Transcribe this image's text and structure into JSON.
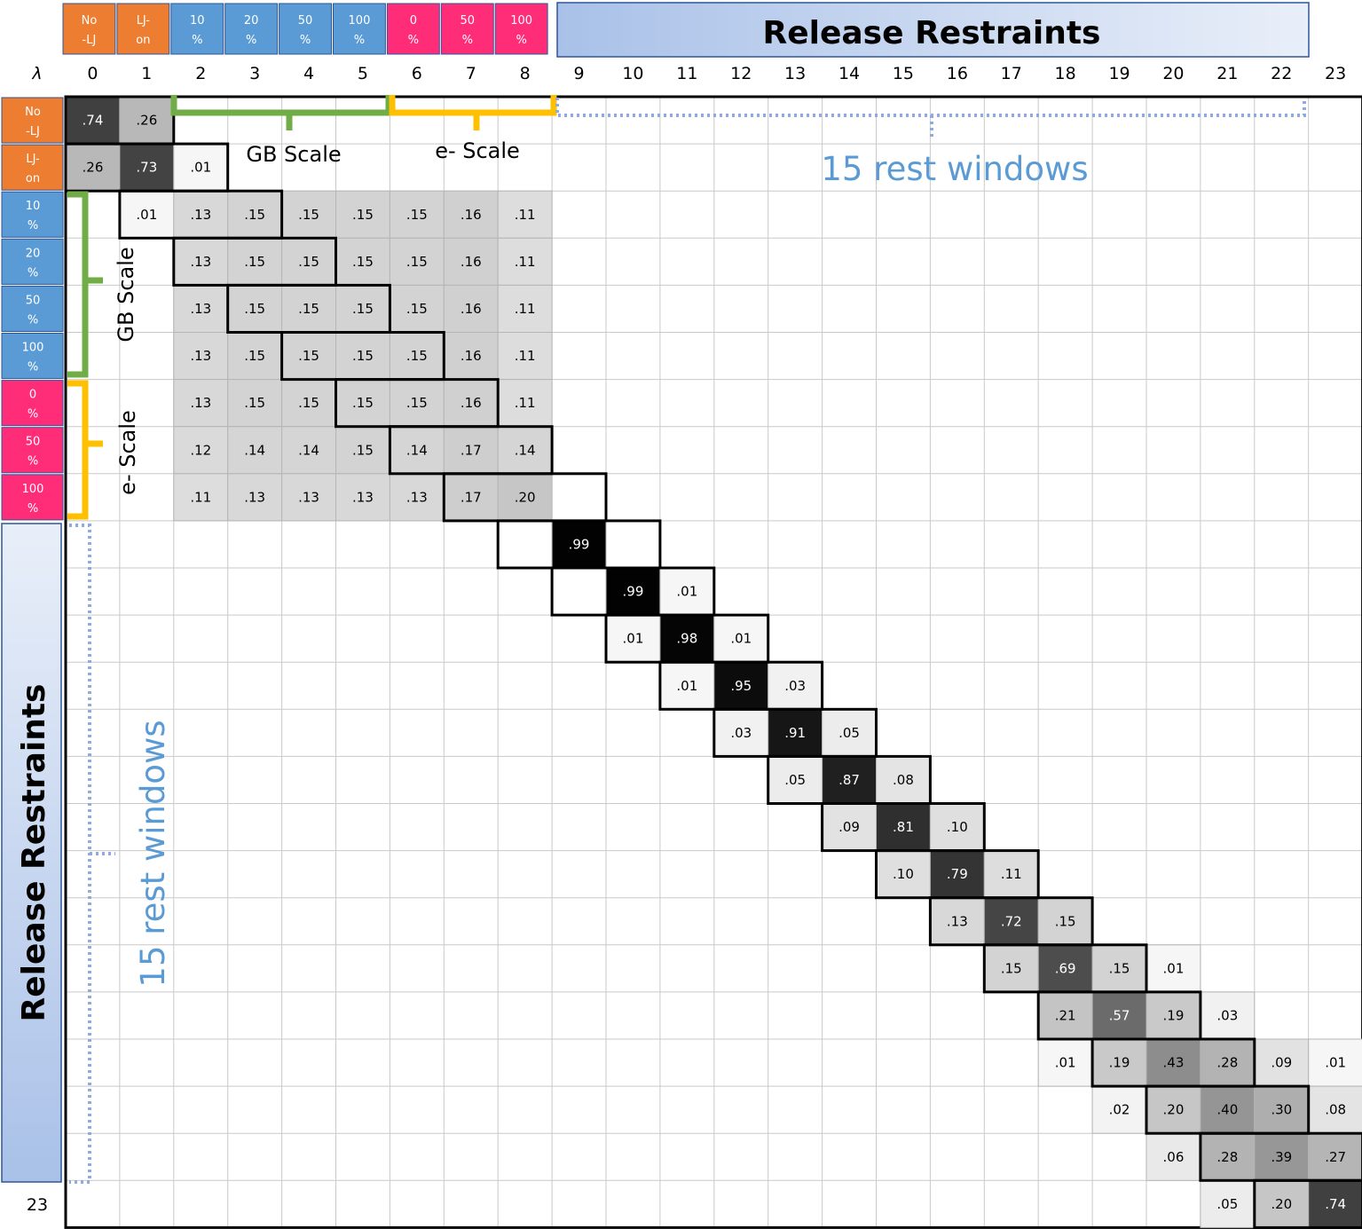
{
  "chart_data": {
    "type": "heatmap",
    "title": "",
    "lambda_symbol": "λ",
    "column_indices": [
      "0",
      "1",
      "2",
      "3",
      "4",
      "5",
      "6",
      "7",
      "8",
      "9",
      "10",
      "11",
      "12",
      "13",
      "14",
      "15",
      "16",
      "17",
      "18",
      "19",
      "20",
      "21",
      "22",
      "23"
    ],
    "row_bottom_index": "23",
    "banner_title": "Release Restraints",
    "state_labels": [
      {
        "line1": "No",
        "line2": "-LJ",
        "group": "lj"
      },
      {
        "line1": "LJ-",
        "line2": "on",
        "group": "lj"
      },
      {
        "line1": "10",
        "line2": "%",
        "group": "gb"
      },
      {
        "line1": "20",
        "line2": "%",
        "group": "gb"
      },
      {
        "line1": "50",
        "line2": "%",
        "group": "gb"
      },
      {
        "line1": "100",
        "line2": "%",
        "group": "gb"
      },
      {
        "line1": "0",
        "line2": "%",
        "group": "e"
      },
      {
        "line1": "50",
        "line2": "%",
        "group": "e"
      },
      {
        "line1": "100",
        "line2": "%",
        "group": "e"
      }
    ],
    "group_colors": {
      "lj": "#ed7d31",
      "gb": "#5b9bd5",
      "e": "#ff2d78",
      "banner": "#b4c7e7",
      "gb_bracket": "#70ad47",
      "e_bracket": "#ffc000",
      "rest_dots": "#8faadc"
    },
    "annotations": {
      "gb_scale": "GB Scale",
      "e_scale": "e- Scale",
      "rest_windows": "15 rest windows"
    },
    "cells": [
      [
        0,
        0,
        ".74",
        0.74
      ],
      [
        0,
        1,
        ".26",
        0.26
      ],
      [
        1,
        0,
        ".26",
        0.26
      ],
      [
        1,
        1,
        ".73",
        0.73
      ],
      [
        1,
        2,
        ".01",
        0.01
      ],
      [
        2,
        1,
        ".01",
        0.01
      ],
      [
        2,
        2,
        ".13",
        0.13
      ],
      [
        2,
        3,
        ".15",
        0.15
      ],
      [
        2,
        4,
        ".15",
        0.15
      ],
      [
        2,
        5,
        ".15",
        0.15
      ],
      [
        2,
        6,
        ".15",
        0.15
      ],
      [
        2,
        7,
        ".16",
        0.16
      ],
      [
        2,
        8,
        ".11",
        0.11
      ],
      [
        3,
        2,
        ".13",
        0.13
      ],
      [
        3,
        3,
        ".15",
        0.15
      ],
      [
        3,
        4,
        ".15",
        0.15
      ],
      [
        3,
        5,
        ".15",
        0.15
      ],
      [
        3,
        6,
        ".15",
        0.15
      ],
      [
        3,
        7,
        ".16",
        0.16
      ],
      [
        3,
        8,
        ".11",
        0.11
      ],
      [
        4,
        2,
        ".13",
        0.13
      ],
      [
        4,
        3,
        ".15",
        0.15
      ],
      [
        4,
        4,
        ".15",
        0.15
      ],
      [
        4,
        5,
        ".15",
        0.15
      ],
      [
        4,
        6,
        ".15",
        0.15
      ],
      [
        4,
        7,
        ".16",
        0.16
      ],
      [
        4,
        8,
        ".11",
        0.11
      ],
      [
        5,
        2,
        ".13",
        0.13
      ],
      [
        5,
        3,
        ".15",
        0.15
      ],
      [
        5,
        4,
        ".15",
        0.15
      ],
      [
        5,
        5,
        ".15",
        0.15
      ],
      [
        5,
        6,
        ".15",
        0.15
      ],
      [
        5,
        7,
        ".16",
        0.16
      ],
      [
        5,
        8,
        ".11",
        0.11
      ],
      [
        6,
        2,
        ".13",
        0.13
      ],
      [
        6,
        3,
        ".15",
        0.15
      ],
      [
        6,
        4,
        ".15",
        0.15
      ],
      [
        6,
        5,
        ".15",
        0.15
      ],
      [
        6,
        6,
        ".15",
        0.15
      ],
      [
        6,
        7,
        ".16",
        0.16
      ],
      [
        6,
        8,
        ".11",
        0.11
      ],
      [
        7,
        2,
        ".12",
        0.12
      ],
      [
        7,
        3,
        ".14",
        0.14
      ],
      [
        7,
        4,
        ".14",
        0.14
      ],
      [
        7,
        5,
        ".15",
        0.15
      ],
      [
        7,
        6,
        ".14",
        0.14
      ],
      [
        7,
        7,
        ".17",
        0.17
      ],
      [
        7,
        8,
        ".14",
        0.14
      ],
      [
        8,
        2,
        ".11",
        0.11
      ],
      [
        8,
        3,
        ".13",
        0.13
      ],
      [
        8,
        4,
        ".13",
        0.13
      ],
      [
        8,
        5,
        ".13",
        0.13
      ],
      [
        8,
        6,
        ".13",
        0.13
      ],
      [
        8,
        7,
        ".17",
        0.17
      ],
      [
        8,
        8,
        ".20",
        0.2
      ],
      [
        9,
        9,
        ".99",
        0.99
      ],
      [
        10,
        10,
        ".99",
        0.99
      ],
      [
        10,
        11,
        ".01",
        0.01
      ],
      [
        11,
        10,
        ".01",
        0.01
      ],
      [
        11,
        11,
        ".98",
        0.98
      ],
      [
        11,
        12,
        ".01",
        0.01
      ],
      [
        12,
        11,
        ".01",
        0.01
      ],
      [
        12,
        12,
        ".95",
        0.95
      ],
      [
        12,
        13,
        ".03",
        0.03
      ],
      [
        13,
        12,
        ".03",
        0.03
      ],
      [
        13,
        13,
        ".91",
        0.91
      ],
      [
        13,
        14,
        ".05",
        0.05
      ],
      [
        14,
        13,
        ".05",
        0.05
      ],
      [
        14,
        14,
        ".87",
        0.87
      ],
      [
        14,
        15,
        ".08",
        0.08
      ],
      [
        15,
        14,
        ".09",
        0.09
      ],
      [
        15,
        15,
        ".81",
        0.81
      ],
      [
        15,
        16,
        ".10",
        0.1
      ],
      [
        16,
        15,
        ".10",
        0.1
      ],
      [
        16,
        16,
        ".79",
        0.79
      ],
      [
        16,
        17,
        ".11",
        0.11
      ],
      [
        17,
        16,
        ".13",
        0.13
      ],
      [
        17,
        17,
        ".72",
        0.72
      ],
      [
        17,
        18,
        ".15",
        0.15
      ],
      [
        18,
        17,
        ".15",
        0.15
      ],
      [
        18,
        18,
        ".69",
        0.69
      ],
      [
        18,
        19,
        ".15",
        0.15
      ],
      [
        18,
        20,
        ".01",
        0.01
      ],
      [
        19,
        18,
        ".21",
        0.21
      ],
      [
        19,
        19,
        ".57",
        0.57
      ],
      [
        19,
        20,
        ".19",
        0.19
      ],
      [
        19,
        21,
        ".03",
        0.03
      ],
      [
        20,
        18,
        ".01",
        0.01
      ],
      [
        20,
        19,
        ".19",
        0.19
      ],
      [
        20,
        20,
        ".43",
        0.43
      ],
      [
        20,
        21,
        ".28",
        0.28
      ],
      [
        20,
        22,
        ".09",
        0.09
      ],
      [
        20,
        23,
        ".01",
        0.01
      ],
      [
        21,
        19,
        ".02",
        0.02
      ],
      [
        21,
        20,
        ".20",
        0.2
      ],
      [
        21,
        21,
        ".40",
        0.4
      ],
      [
        21,
        22,
        ".30",
        0.3
      ],
      [
        21,
        23,
        ".08",
        0.08
      ],
      [
        22,
        20,
        ".06",
        0.06
      ],
      [
        22,
        21,
        ".28",
        0.28
      ],
      [
        22,
        22,
        ".39",
        0.39
      ],
      [
        22,
        23,
        ".27",
        0.27
      ],
      [
        23,
        21,
        ".05",
        0.05
      ],
      [
        23,
        22,
        ".20",
        0.2
      ],
      [
        23,
        23,
        ".74",
        0.74
      ]
    ]
  }
}
